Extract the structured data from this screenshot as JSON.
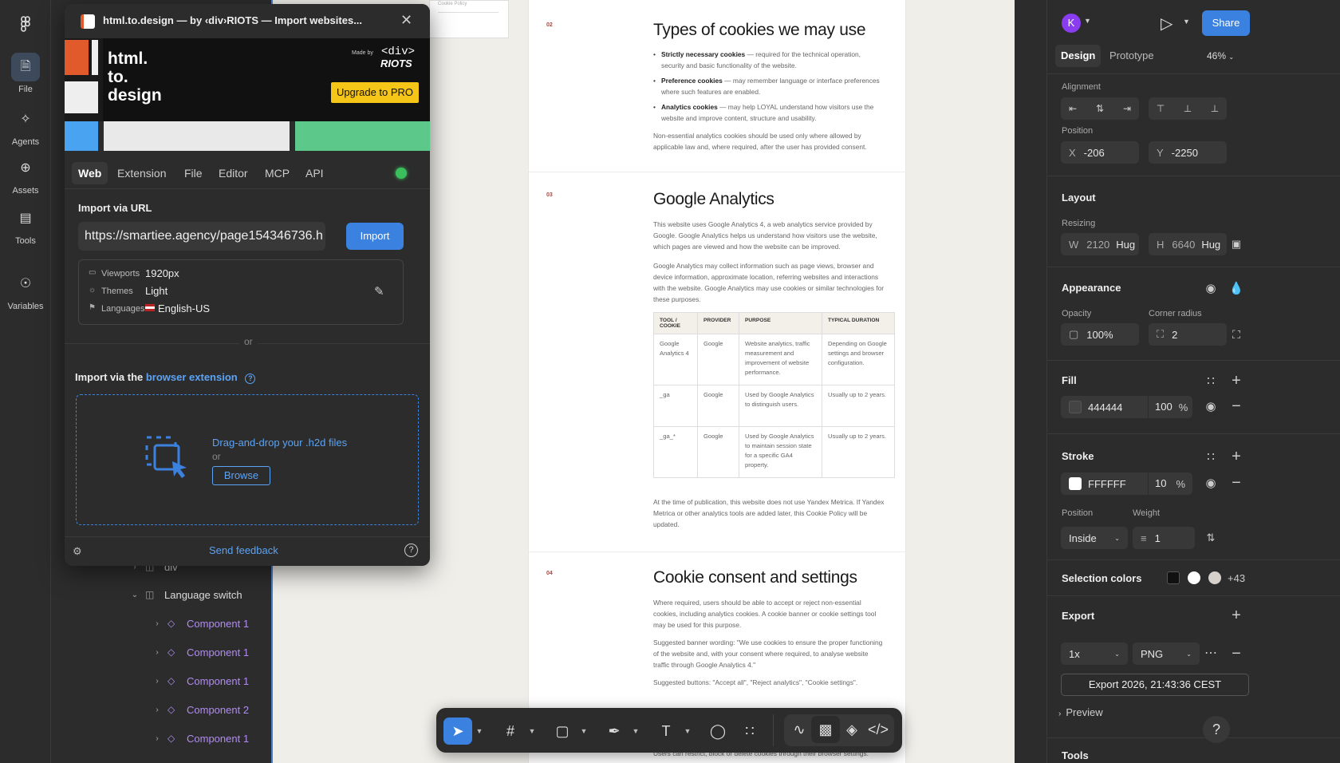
{
  "left_rail": {
    "items": [
      {
        "label": "File",
        "icon": "file-icon"
      },
      {
        "label": "Agents",
        "icon": "agents-icon"
      },
      {
        "label": "Assets",
        "icon": "assets-icon"
      },
      {
        "label": "Tools",
        "icon": "tools-icon"
      },
      {
        "label": "Variables",
        "icon": "variables-icon"
      }
    ]
  },
  "layers": {
    "items": [
      {
        "label": "div",
        "type": "frame"
      },
      {
        "label": "Language switch",
        "type": "frame"
      },
      {
        "label": "Component 1",
        "type": "component"
      },
      {
        "label": "Component 1",
        "type": "component"
      },
      {
        "label": "Component 1",
        "type": "component"
      },
      {
        "label": "Component 2",
        "type": "component"
      },
      {
        "label": "Component 1",
        "type": "component"
      }
    ]
  },
  "plugin": {
    "title": "html.to.design — by ‹div›RIOTS — Import websites...",
    "banner": {
      "logo_lines": [
        "html.",
        "to.",
        "design"
      ],
      "made_by": "Made by",
      "brand_line1": "<div>",
      "brand_line2": "RIOTS",
      "upgrade_label": "Upgrade to PRO"
    },
    "tabs": [
      "Web",
      "Extension",
      "File",
      "Editor",
      "MCP",
      "API"
    ],
    "import_url": {
      "heading": "Import via URL",
      "value": "https://smartiee.agency/page154346736.h",
      "button": "Import"
    },
    "settings": {
      "viewports_label": "Viewports",
      "viewports_value": "1920px",
      "themes_label": "Themes",
      "themes_value": "Light",
      "languages_label": "Languages",
      "languages_value": "English-US"
    },
    "or_label": "or",
    "extension": {
      "heading_prefix": "Import via the ",
      "heading_link": "browser extension",
      "drop_label": "Drag-and-drop your .h2d files",
      "or_label": "or",
      "browse_label": "Browse"
    },
    "footer": {
      "feedback": "Send feedback"
    }
  },
  "canvas": {
    "top_card_text": "Cookie Policy",
    "sections": [
      {
        "num": "02",
        "title": "Types of cookies we may use",
        "bullets": [
          {
            "bold": "Strictly necessary cookies",
            "text": " — required for the technical operation, security and basic functionality of the website."
          },
          {
            "bold": "Preference cookies",
            "text": " — may remember language or interface preferences where such features are enabled."
          },
          {
            "bold": "Analytics cookies",
            "text": " — may help LOYAL understand how visitors use the website and improve content, structure and usability."
          }
        ],
        "paragraph": "Non-essential analytics cookies should be used only where allowed by applicable law and, where required, after the user has provided consent."
      },
      {
        "num": "03",
        "title": "Google Analytics",
        "p1": "This website uses Google Analytics 4, a web analytics service provided by Google. Google Analytics helps us understand how visitors use the website, which pages are viewed and how the website can be improved.",
        "p2": "Google Analytics may collect information such as page views, browser and device information, approximate location, referring websites and interactions with the website. Google Analytics may use cookies or similar technologies for these purposes.",
        "table": {
          "headers": [
            "TOOL / COOKIE",
            "PROVIDER",
            "PURPOSE",
            "TYPICAL DURATION"
          ],
          "rows": [
            [
              "Google Analytics 4",
              "Google",
              "Website analytics, traffic measurement and improvement of website performance.",
              "Depending on Google settings and browser configuration."
            ],
            [
              "_ga",
              "Google",
              "Used by Google Analytics to distinguish users.",
              "Usually up to 2 years."
            ],
            [
              "_ga_*",
              "Google",
              "Used by Google Analytics to maintain session state for a specific GA4 property.",
              "Usually up to 2 years."
            ]
          ]
        },
        "p3": "At the time of publication, this website does not use Yandex Metrica. If Yandex Metrica or other analytics tools are added later, this Cookie Policy will be updated."
      },
      {
        "num": "04",
        "title": "Cookie consent and settings",
        "p1": "Where required, users should be able to accept or reject non-essential cookies, including analytics cookies. A cookie banner or cookie settings tool may be used for this purpose.",
        "p2": "Suggested banner wording: \"We use cookies to ensure the proper functioning of the website and, with your consent where required, to analyse website traffic through Google Analytics 4.\"",
        "p3": "Suggested buttons: \"Accept all\", \"Reject analytics\", \"Cookie settings\".",
        "p4": "Users can restrict, block or delete cookies through their browser settings."
      }
    ]
  },
  "right_panel": {
    "avatar": "K",
    "share_label": "Share",
    "tabs": [
      "Design",
      "Prototype"
    ],
    "zoom": "46%",
    "alignment_title": "Alignment",
    "position_title": "Position",
    "x_label": "X",
    "x_value": "-206",
    "y_label": "Y",
    "y_value": "-2250",
    "layout_title": "Layout",
    "resizing_title": "Resizing",
    "w_label": "W",
    "w_value": "2120",
    "w_mode": "Hug",
    "h_label": "H",
    "h_value": "6640",
    "h_mode": "Hug",
    "appearance_title": "Appearance",
    "opacity_title": "Opacity",
    "opacity_value": "100%",
    "radius_title": "Corner radius",
    "radius_value": "2",
    "fill_title": "Fill",
    "fill_hex": "444444",
    "fill_opacity": "100",
    "fill_pct": "%",
    "stroke_title": "Stroke",
    "stroke_hex": "FFFFFF",
    "stroke_opacity": "10",
    "stroke_pct": "%",
    "stroke_position_title": "Position",
    "stroke_position_value": "Inside",
    "weight_title": "Weight",
    "weight_value": "1",
    "selection_colors_title": "Selection colors",
    "selection_more": "+43",
    "export_title": "Export",
    "export_scale": "1x",
    "export_format": "PNG",
    "export_button": "Export 2026, 21:43:36 CEST",
    "preview_label": "Preview",
    "tools_title": "Tools",
    "help_label": "?"
  },
  "colors": {
    "accent": "#3b82e0",
    "fill_color": "#444444",
    "component_purple": "#b18cf0",
    "banner_orange": "#e05a2b",
    "banner_green": "#5cc98a",
    "banner_blue": "#4aa3f0",
    "upgrade_yellow": "#f5c518"
  }
}
